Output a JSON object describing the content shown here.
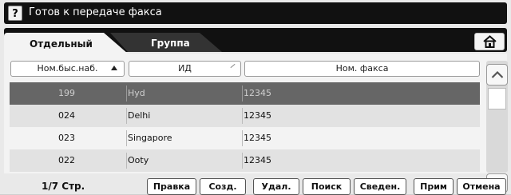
{
  "status": {
    "help_label": "?",
    "message": "Готов к передаче факса"
  },
  "tabs": [
    {
      "label": "Отдельный",
      "active": true
    },
    {
      "label": "Группа",
      "active": false
    }
  ],
  "home_icon": "home-icon",
  "columns": [
    {
      "label": "Ном.быс.наб.",
      "sort": "ascending"
    },
    {
      "label": "ИД"
    },
    {
      "label": "Ном. факса"
    }
  ],
  "rows": [
    {
      "speed_dial": "199",
      "id": "Hyd",
      "fax": "12345",
      "selected": true
    },
    {
      "speed_dial": "024",
      "id": "Delhi",
      "fax": "12345"
    },
    {
      "speed_dial": "023",
      "id": "Singapore",
      "fax": "12345"
    },
    {
      "speed_dial": "022",
      "id": "Ooty",
      "fax": "12345"
    }
  ],
  "pagination": {
    "label": "1/7 Стр."
  },
  "footer_buttons": [
    "Правка",
    "Созд.",
    "Удал.",
    "Поиск",
    "Сведен.",
    "Прим",
    "Отмена"
  ],
  "colors": {
    "title_bg": "#111111",
    "selected_row": "#666666",
    "panel_bg": "#f3f3f3"
  }
}
